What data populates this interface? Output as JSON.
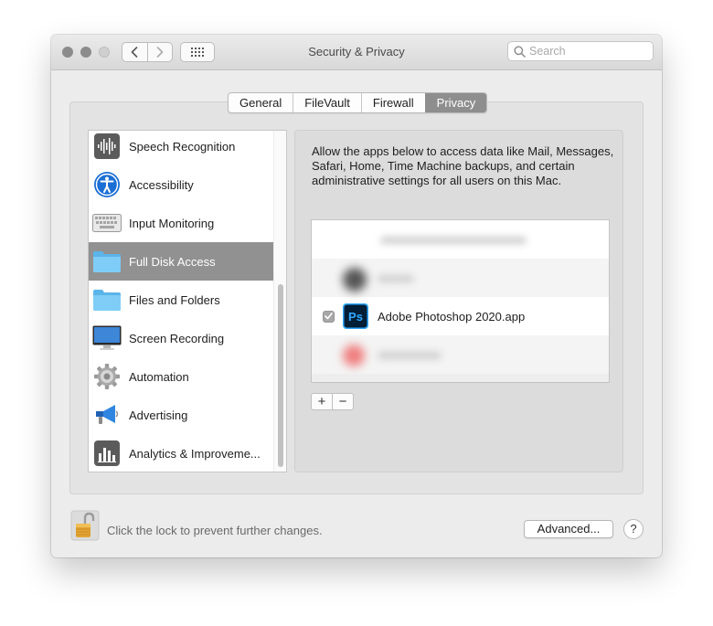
{
  "window": {
    "title": "Security & Privacy",
    "search": {
      "placeholder": "Search",
      "value": ""
    }
  },
  "tabs": [
    {
      "label": "General",
      "active": false
    },
    {
      "label": "FileVault",
      "active": false
    },
    {
      "label": "Firewall",
      "active": false
    },
    {
      "label": "Privacy",
      "active": true
    }
  ],
  "sidebar": {
    "items": [
      {
        "label": "Speech Recognition",
        "icon": "waveform-icon",
        "selected": false
      },
      {
        "label": "Accessibility",
        "icon": "accessibility-icon",
        "selected": false
      },
      {
        "label": "Input Monitoring",
        "icon": "keyboard-icon",
        "selected": false
      },
      {
        "label": "Full Disk Access",
        "icon": "folder-icon",
        "selected": true
      },
      {
        "label": "Files and Folders",
        "icon": "folder-icon",
        "selected": false
      },
      {
        "label": "Screen Recording",
        "icon": "display-icon",
        "selected": false
      },
      {
        "label": "Automation",
        "icon": "gear-icon",
        "selected": false
      },
      {
        "label": "Advertising",
        "icon": "megaphone-icon",
        "selected": false
      },
      {
        "label": "Analytics & Improveme...",
        "icon": "bar-chart-icon",
        "selected": false
      }
    ]
  },
  "panel": {
    "description": "Allow the apps below to access data like Mail, Messages, Safari, Home, Time Machine backups, and certain administrative settings for all users on this Mac.",
    "apps": [
      {
        "name": "Adobe Photoshop 2020.app",
        "checked": true,
        "icon": "photoshop-icon"
      }
    ],
    "add_label": "+",
    "remove_label": "−"
  },
  "footer": {
    "lock_text": "Click the lock to prevent further changes.",
    "advanced_label": "Advanced...",
    "help_label": "?"
  },
  "colors": {
    "selection": "#919191",
    "active_tab": "#8e8e8e",
    "photoshop_bg": "#001e36",
    "photoshop_accent": "#31a8ff"
  }
}
